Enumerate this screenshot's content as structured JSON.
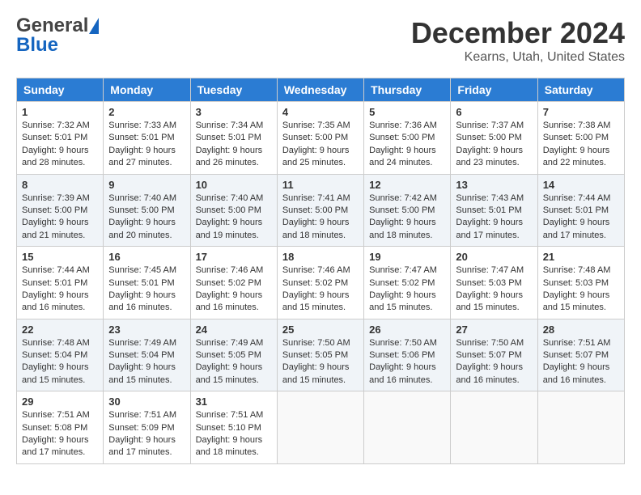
{
  "header": {
    "logo_general": "General",
    "logo_blue": "Blue",
    "month_year": "December 2024",
    "location": "Kearns, Utah, United States"
  },
  "weekdays": [
    "Sunday",
    "Monday",
    "Tuesday",
    "Wednesday",
    "Thursday",
    "Friday",
    "Saturday"
  ],
  "weeks": [
    [
      {
        "day": "1",
        "sunrise": "Sunrise: 7:32 AM",
        "sunset": "Sunset: 5:01 PM",
        "daylight": "Daylight: 9 hours and 28 minutes."
      },
      {
        "day": "2",
        "sunrise": "Sunrise: 7:33 AM",
        "sunset": "Sunset: 5:01 PM",
        "daylight": "Daylight: 9 hours and 27 minutes."
      },
      {
        "day": "3",
        "sunrise": "Sunrise: 7:34 AM",
        "sunset": "Sunset: 5:01 PM",
        "daylight": "Daylight: 9 hours and 26 minutes."
      },
      {
        "day": "4",
        "sunrise": "Sunrise: 7:35 AM",
        "sunset": "Sunset: 5:00 PM",
        "daylight": "Daylight: 9 hours and 25 minutes."
      },
      {
        "day": "5",
        "sunrise": "Sunrise: 7:36 AM",
        "sunset": "Sunset: 5:00 PM",
        "daylight": "Daylight: 9 hours and 24 minutes."
      },
      {
        "day": "6",
        "sunrise": "Sunrise: 7:37 AM",
        "sunset": "Sunset: 5:00 PM",
        "daylight": "Daylight: 9 hours and 23 minutes."
      },
      {
        "day": "7",
        "sunrise": "Sunrise: 7:38 AM",
        "sunset": "Sunset: 5:00 PM",
        "daylight": "Daylight: 9 hours and 22 minutes."
      }
    ],
    [
      {
        "day": "8",
        "sunrise": "Sunrise: 7:39 AM",
        "sunset": "Sunset: 5:00 PM",
        "daylight": "Daylight: 9 hours and 21 minutes."
      },
      {
        "day": "9",
        "sunrise": "Sunrise: 7:40 AM",
        "sunset": "Sunset: 5:00 PM",
        "daylight": "Daylight: 9 hours and 20 minutes."
      },
      {
        "day": "10",
        "sunrise": "Sunrise: 7:40 AM",
        "sunset": "Sunset: 5:00 PM",
        "daylight": "Daylight: 9 hours and 19 minutes."
      },
      {
        "day": "11",
        "sunrise": "Sunrise: 7:41 AM",
        "sunset": "Sunset: 5:00 PM",
        "daylight": "Daylight: 9 hours and 18 minutes."
      },
      {
        "day": "12",
        "sunrise": "Sunrise: 7:42 AM",
        "sunset": "Sunset: 5:00 PM",
        "daylight": "Daylight: 9 hours and 18 minutes."
      },
      {
        "day": "13",
        "sunrise": "Sunrise: 7:43 AM",
        "sunset": "Sunset: 5:01 PM",
        "daylight": "Daylight: 9 hours and 17 minutes."
      },
      {
        "day": "14",
        "sunrise": "Sunrise: 7:44 AM",
        "sunset": "Sunset: 5:01 PM",
        "daylight": "Daylight: 9 hours and 17 minutes."
      }
    ],
    [
      {
        "day": "15",
        "sunrise": "Sunrise: 7:44 AM",
        "sunset": "Sunset: 5:01 PM",
        "daylight": "Daylight: 9 hours and 16 minutes."
      },
      {
        "day": "16",
        "sunrise": "Sunrise: 7:45 AM",
        "sunset": "Sunset: 5:01 PM",
        "daylight": "Daylight: 9 hours and 16 minutes."
      },
      {
        "day": "17",
        "sunrise": "Sunrise: 7:46 AM",
        "sunset": "Sunset: 5:02 PM",
        "daylight": "Daylight: 9 hours and 16 minutes."
      },
      {
        "day": "18",
        "sunrise": "Sunrise: 7:46 AM",
        "sunset": "Sunset: 5:02 PM",
        "daylight": "Daylight: 9 hours and 15 minutes."
      },
      {
        "day": "19",
        "sunrise": "Sunrise: 7:47 AM",
        "sunset": "Sunset: 5:02 PM",
        "daylight": "Daylight: 9 hours and 15 minutes."
      },
      {
        "day": "20",
        "sunrise": "Sunrise: 7:47 AM",
        "sunset": "Sunset: 5:03 PM",
        "daylight": "Daylight: 9 hours and 15 minutes."
      },
      {
        "day": "21",
        "sunrise": "Sunrise: 7:48 AM",
        "sunset": "Sunset: 5:03 PM",
        "daylight": "Daylight: 9 hours and 15 minutes."
      }
    ],
    [
      {
        "day": "22",
        "sunrise": "Sunrise: 7:48 AM",
        "sunset": "Sunset: 5:04 PM",
        "daylight": "Daylight: 9 hours and 15 minutes."
      },
      {
        "day": "23",
        "sunrise": "Sunrise: 7:49 AM",
        "sunset": "Sunset: 5:04 PM",
        "daylight": "Daylight: 9 hours and 15 minutes."
      },
      {
        "day": "24",
        "sunrise": "Sunrise: 7:49 AM",
        "sunset": "Sunset: 5:05 PM",
        "daylight": "Daylight: 9 hours and 15 minutes."
      },
      {
        "day": "25",
        "sunrise": "Sunrise: 7:50 AM",
        "sunset": "Sunset: 5:05 PM",
        "daylight": "Daylight: 9 hours and 15 minutes."
      },
      {
        "day": "26",
        "sunrise": "Sunrise: 7:50 AM",
        "sunset": "Sunset: 5:06 PM",
        "daylight": "Daylight: 9 hours and 16 minutes."
      },
      {
        "day": "27",
        "sunrise": "Sunrise: 7:50 AM",
        "sunset": "Sunset: 5:07 PM",
        "daylight": "Daylight: 9 hours and 16 minutes."
      },
      {
        "day": "28",
        "sunrise": "Sunrise: 7:51 AM",
        "sunset": "Sunset: 5:07 PM",
        "daylight": "Daylight: 9 hours and 16 minutes."
      }
    ],
    [
      {
        "day": "29",
        "sunrise": "Sunrise: 7:51 AM",
        "sunset": "Sunset: 5:08 PM",
        "daylight": "Daylight: 9 hours and 17 minutes."
      },
      {
        "day": "30",
        "sunrise": "Sunrise: 7:51 AM",
        "sunset": "Sunset: 5:09 PM",
        "daylight": "Daylight: 9 hours and 17 minutes."
      },
      {
        "day": "31",
        "sunrise": "Sunrise: 7:51 AM",
        "sunset": "Sunset: 5:10 PM",
        "daylight": "Daylight: 9 hours and 18 minutes."
      },
      null,
      null,
      null,
      null
    ]
  ]
}
